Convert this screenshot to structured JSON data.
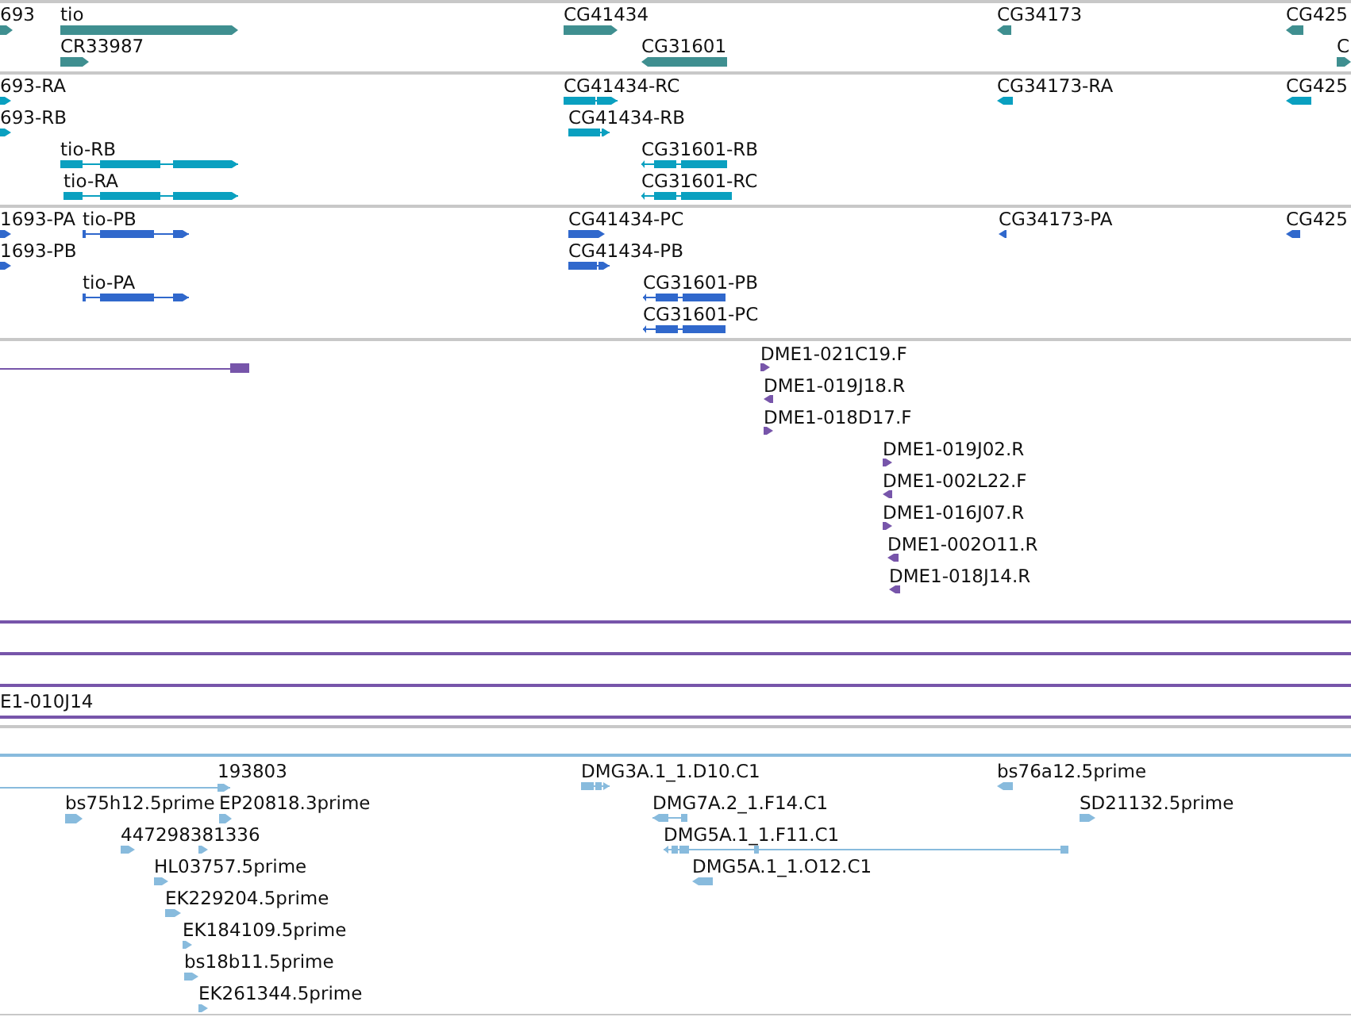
{
  "tracks": [
    {
      "kind": "gene",
      "color": "#3f8f90",
      "features": [
        {
          "kind": "arrow",
          "label": "693",
          "reverse": false
        },
        {
          "kind": "arrow",
          "label": "tio",
          "reverse": false
        },
        {
          "kind": "arrow",
          "label": "CR33987",
          "reverse": false
        },
        {
          "kind": "arrow",
          "label": "CG41434",
          "reverse": false
        },
        {
          "kind": "arrow",
          "label": "CG31601",
          "reverse": true
        },
        {
          "kind": "arrow",
          "label": "CG34173",
          "reverse": true
        },
        {
          "kind": "arrow",
          "label": "CG425",
          "reverse": true
        },
        {
          "kind": "arrow",
          "label": "C",
          "reverse": false
        }
      ]
    },
    {
      "kind": "transcript",
      "color": "#0aa0c0",
      "features": [
        {
          "kind": "arrow",
          "label": "693-RA",
          "reverse": false
        },
        {
          "kind": "arrow",
          "label": "693-RB",
          "reverse": false
        },
        {
          "kind": "arrow",
          "label": "tio-RB",
          "reverse": false
        },
        {
          "kind": "arrow",
          "label": "tio-RA",
          "reverse": false
        },
        {
          "kind": "arrow",
          "label": "CG41434-RC",
          "reverse": false
        },
        {
          "kind": "arrow",
          "label": "CG41434-RB",
          "reverse": false
        },
        {
          "kind": "arrow",
          "label": "CG31601-RB",
          "reverse": true
        },
        {
          "kind": "arrow",
          "label": "CG31601-RC",
          "reverse": true
        },
        {
          "kind": "arrow",
          "label": "CG34173-RA",
          "reverse": true
        },
        {
          "kind": "arrow",
          "label": "CG425",
          "reverse": true
        }
      ]
    },
    {
      "kind": "protein",
      "color": "#3068cc",
      "features": [
        {
          "kind": "arrow",
          "label": "1693-PA",
          "reverse": false
        },
        {
          "kind": "arrow",
          "label": "tio-PB",
          "reverse": false
        },
        {
          "kind": "arrow",
          "label": "1693-PB",
          "reverse": false
        },
        {
          "kind": "arrow",
          "label": "tio-PA",
          "reverse": false
        },
        {
          "kind": "arrow",
          "label": "CG41434-PC",
          "reverse": false
        },
        {
          "kind": "arrow",
          "label": "CG41434-PB",
          "reverse": false
        },
        {
          "kind": "arrow",
          "label": "CG31601-PB",
          "reverse": true
        },
        {
          "kind": "arrow",
          "label": "CG31601-PC",
          "reverse": true
        },
        {
          "kind": "arrow",
          "label": "CG34173-PA",
          "reverse": true
        },
        {
          "kind": "arrow",
          "label": "CG425",
          "reverse": true
        }
      ]
    },
    {
      "kind": "clone",
      "color": "#7755aa",
      "features": [
        {
          "kind": "line"
        },
        {
          "kind": "arrow",
          "label": "DME1-021C19.F",
          "reverse": false
        },
        {
          "kind": "arrow",
          "label": "DME1-019J18.R",
          "reverse": true
        },
        {
          "kind": "arrow",
          "label": "DME1-018D17.F",
          "reverse": false
        },
        {
          "kind": "arrow",
          "label": "DME1-019J02.R",
          "reverse": false
        },
        {
          "kind": "arrow",
          "label": "DME1-002L22.F",
          "reverse": true
        },
        {
          "kind": "arrow",
          "label": "DME1-016J07.R",
          "reverse": false
        },
        {
          "kind": "arrow",
          "label": "DME1-002O11.R",
          "reverse": true
        },
        {
          "kind": "arrow",
          "label": "DME1-018J14.R",
          "reverse": true
        },
        {
          "kind": "line"
        },
        {
          "kind": "line"
        },
        {
          "kind": "line"
        },
        {
          "kind": "line",
          "label": "E1-010J14"
        }
      ]
    },
    {
      "kind": "est",
      "color": "#88bbdd",
      "features": [
        {
          "kind": "line"
        },
        {
          "kind": "arrow",
          "label": "193803",
          "reverse": false
        },
        {
          "kind": "arrow",
          "label": "bs75h12.5prime",
          "reverse": false
        },
        {
          "kind": "arrow",
          "label": "EP20818.3prime",
          "reverse": false
        },
        {
          "kind": "arrow",
          "label": "447298381336",
          "reverse": false
        },
        {
          "kind": "arrow",
          "reverse": false
        },
        {
          "kind": "arrow",
          "label": "HL03757.5prime",
          "reverse": false
        },
        {
          "kind": "arrow",
          "label": "EK229204.5prime",
          "reverse": false
        },
        {
          "kind": "arrow",
          "label": "EK184109.5prime",
          "reverse": false
        },
        {
          "kind": "arrow",
          "label": "bs18b11.5prime",
          "reverse": false
        },
        {
          "kind": "arrow",
          "label": "EK261344.5prime",
          "reverse": false
        },
        {
          "kind": "arrow",
          "label": "DMG3A.1_1.D10.C1",
          "reverse": false
        },
        {
          "kind": "arrow",
          "label": "DMG7A.2_1.F14.C1",
          "reverse": true
        },
        {
          "kind": "arrow",
          "label": "DMG5A.1_1.F11.C1",
          "reverse": true
        },
        {
          "kind": "arrow",
          "label": "DMG5A.1_1.O12.C1",
          "reverse": true
        },
        {
          "kind": "arrow",
          "label": "bs76a12.5prime",
          "reverse": true
        },
        {
          "kind": "arrow",
          "label": "SD21132.5prime",
          "reverse": false
        }
      ]
    }
  ]
}
